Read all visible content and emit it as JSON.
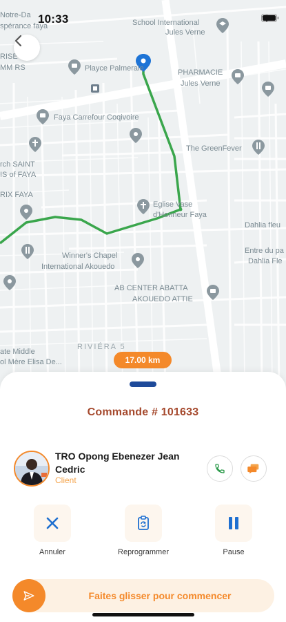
{
  "status_bar": {
    "time": "10:33"
  },
  "map": {
    "labels": {
      "notre_dame": "Notre-Da",
      "esperance": "spérance faya",
      "school": "School International",
      "school2": "Jules Verne",
      "rise": "RISE",
      "mm_rs": "MM RS",
      "playce": "Playce Palmeraie",
      "pharmacie": "PHARMACIE",
      "pharmacie2": "Jules Verne",
      "carrefour": "Faya Carrefour Coqivoire",
      "greenfever": "The GreenFever",
      "church_saint": "rch SAINT",
      "church_faya": "IS of FAYA",
      "rix_faya": "RIX FAYA",
      "eglise": "Eglise Vase",
      "eglise2": "d'Honneur Faya",
      "dahlia": "Dahlia fleu",
      "entre": "Entre du pa",
      "dahlia2": "Dahlia Fle",
      "winners": "Winner's Chapel",
      "winners2": "International Akouedo",
      "abcenter": "AB CENTER ABATTA",
      "abcenter2": "AKOUEDO ATTIE",
      "riviera": "RIVIÉRA 5",
      "middle": "ate Middle",
      "mere": "ol Mère Elisa De..."
    },
    "route_color": "#3aa64c",
    "pin_color": "#1e74d6"
  },
  "distance_badge": "17.00 km",
  "sheet": {
    "order_title": "Commande # 101633",
    "client": {
      "name": "TRO Opong Ebenezer Jean Cedric",
      "role": "Client"
    },
    "actions": [
      {
        "label": "Annuler",
        "icon": "close-icon"
      },
      {
        "label": "Reprogrammer",
        "icon": "clipboard-refresh-icon"
      },
      {
        "label": "Pause",
        "icon": "pause-icon"
      }
    ],
    "slider_label": "Faites glisser pour commencer"
  },
  "colors": {
    "accent": "#f4892a",
    "title": "#a5492d",
    "handle": "#1e4a9a",
    "cancel_icon": "#1e6fd0"
  }
}
